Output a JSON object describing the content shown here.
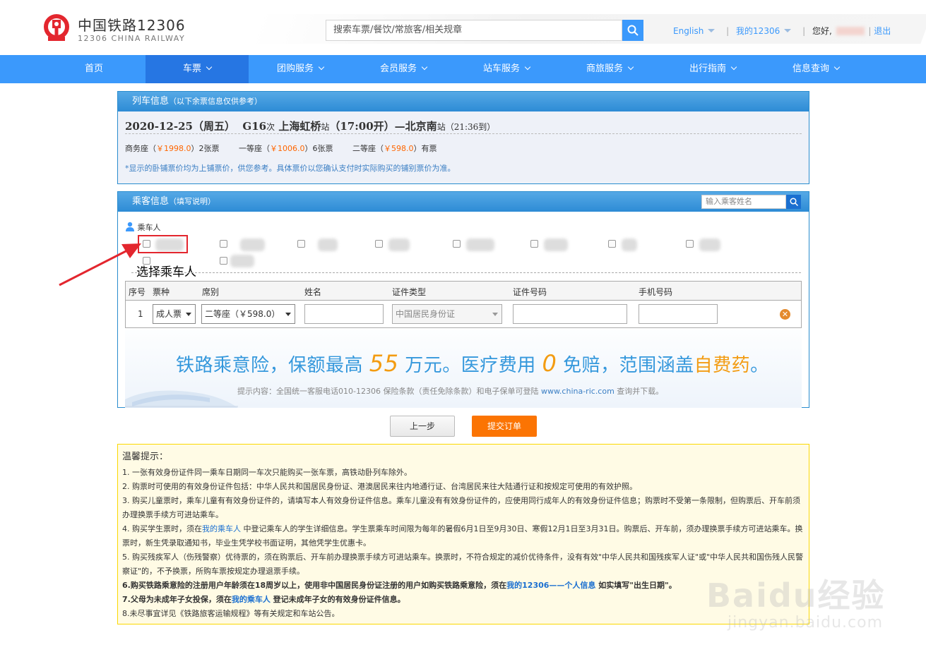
{
  "header": {
    "logo_cn": "中国铁路12306",
    "logo_en": "12306 CHINA RAILWAY",
    "search_placeholder": "搜索车票/餐饮/常旅客/相关规章",
    "lang": "English",
    "my12306": "我的12306",
    "greeting": "您好,",
    "logout": "退出"
  },
  "nav": {
    "items": [
      {
        "label": "首页"
      },
      {
        "label": "车票"
      },
      {
        "label": "团购服务"
      },
      {
        "label": "会员服务"
      },
      {
        "label": "站车服务"
      },
      {
        "label": "商旅服务"
      },
      {
        "label": "出行指南"
      },
      {
        "label": "信息查询"
      }
    ]
  },
  "train": {
    "panel_title": "列车信息",
    "panel_subtitle": "（以下余票信息仅供参考）",
    "date": "2020-12-25（周五）",
    "train_no": "G16",
    "ci": "次",
    "from": "上海虹桥",
    "zhan1": "站",
    "depart": "（17:00开）—",
    "to": "北京南",
    "zhan2": "站",
    "arrive": "（21:36到）",
    "seats": [
      {
        "name": "商务座（",
        "price": "￥1998.0",
        "tail": "）2张票"
      },
      {
        "name": "一等座（",
        "price": "￥1006.0",
        "tail": "）6张票"
      },
      {
        "name": "二等座（",
        "price": "￥598.0",
        "tail": "）有票"
      }
    ],
    "note": "*显示的卧铺票价均为上铺票价，供您参考。具体票价以您确认支付时实际购买的铺别票价为准。"
  },
  "passenger": {
    "panel_title": "乘客信息",
    "panel_subtitle": "（填写说明）",
    "search_placeholder": "输入乘客姓名",
    "label": "乘车人",
    "annotation": "选择乘车人",
    "headers": {
      "no": "序号",
      "ticket_type": "票种",
      "seat": "席别",
      "name": "姓名",
      "id_type": "证件类型",
      "id_no": "证件号码",
      "phone": "手机号码"
    },
    "row": {
      "no": "1",
      "ticket_type": "成人票",
      "seat": "二等座（￥598.0）",
      "id_type": "中国居民身份证"
    }
  },
  "banner": {
    "p1": "铁路乘意险，保额最高 ",
    "n1": "55",
    "p2": " 万元。医疗费用 ",
    "n2": "0",
    "p3": " 免赔，范围涵盖",
    "o3": "自费药",
    "p4": "。",
    "hint1": "提示内容：全国统一客服电话010-12306 保险条款（责任免除条款）和电子保单可登陆 ",
    "url": "www.china-ric.com",
    "hint2": " 查询并下载。"
  },
  "buttons": {
    "prev": "上一步",
    "submit": "提交订单"
  },
  "tips": {
    "title": "温馨提示：",
    "t1": "1. 一张有效身份证件同一乘车日期同一车次只能购买一张车票，高铁动卧列车除外。",
    "t2": "2. 购票时可使用的有效身份证件包括：中华人民共和国居民身份证、港澳居民来往内地通行证、台湾居民来往大陆通行证和按规定可使用的有效护照。",
    "t3": "3. 购买儿童票时，乘车儿童有有效身份证件的，请填写本人有效身份证件信息。乘车儿童没有有效身份证件的，应使用同行成年人的有效身份证件信息；购票时不受第一条限制，但购票后、开车前须办理换票手续方可进站乘车。",
    "t4a": "4. 购买学生票时，须在",
    "t4link": "我的乘车人",
    "t4b": " 中登记乘车人的学生详细信息。学生票乘车时间限为每年的暑假6月1日至9月30日、寒假12月1日至3月31日。购票后、开车前，须办理换票手续方可进站乘车。换票时，新生凭录取通知书，毕业生凭学校书面证明，其他凭学生优惠卡。",
    "t5": "5. 购买残疾军人（伤残警察）优待票的，须在购票后、开车前办理换票手续方可进站乘车。换票时，不符合规定的减价优待条件，没有有效\"中华人民共和国残疾军人证\"或\"中华人民共和国伤残人民警察证\"的，不予换票，所购车票按规定办理退票手续。",
    "t6a": "6.购买铁路乘意险的注册用户年龄须在18周岁以上，使用非中国居民身份证注册的用户如购买铁路乘意险，须在",
    "t6link": "我的12306——个人信息",
    "t6b": " 如实填写\"出生日期\"。",
    "t7a": "7.父母为未成年子女投保，须在",
    "t7link": "我的乘车人",
    "t7b": " 登记未成年子女的有效身份证件信息。",
    "t8": "8.未尽事宜详见《铁路旅客运输规程》等有关规定和车站公告。"
  },
  "watermark": {
    "text": "Baidu经验",
    "url": "jingyan.baidu.com"
  },
  "colors": {
    "primary": "#3b99fc",
    "nav_active": "#2676e3",
    "price": "#ff6600",
    "submit": "#fb7403",
    "annotation_red": "#e3262e"
  }
}
